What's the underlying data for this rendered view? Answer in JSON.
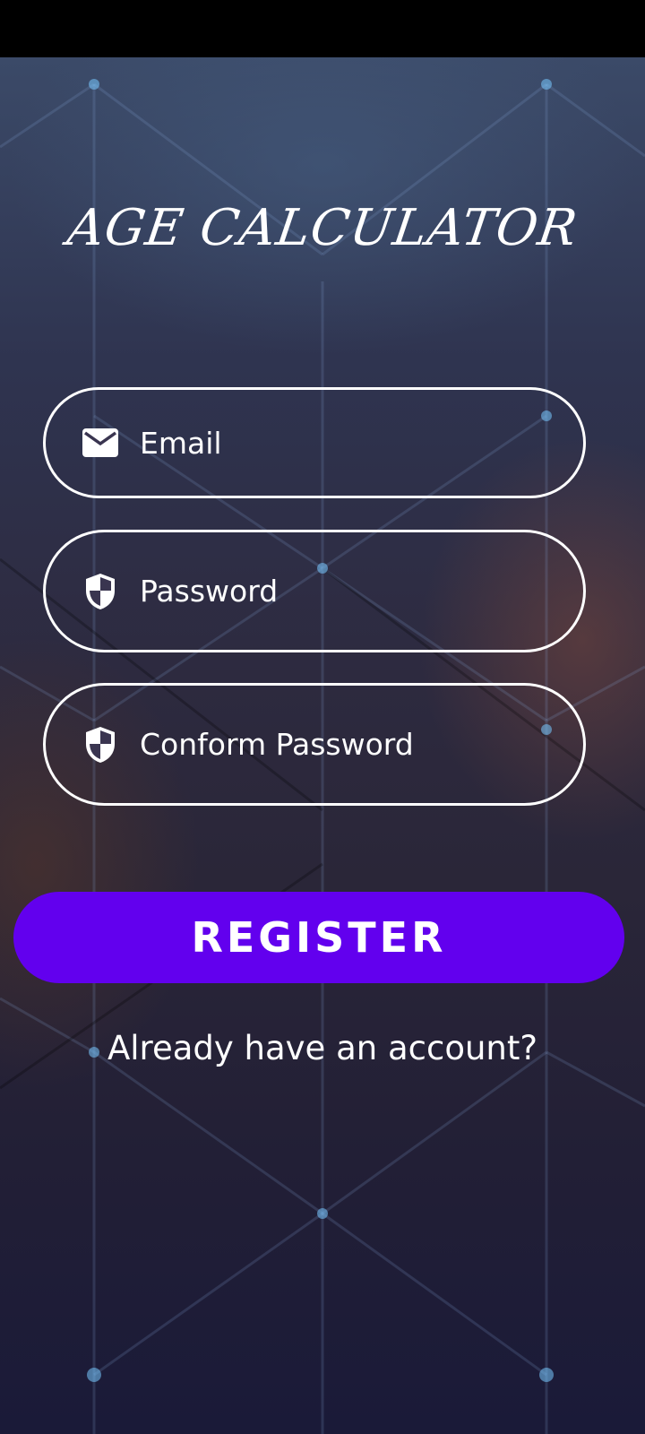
{
  "app": {
    "title": "AGE CALCULATOR"
  },
  "form": {
    "email": {
      "placeholder": "Email",
      "value": "",
      "icon": "mail-icon"
    },
    "password": {
      "placeholder": "Password",
      "value": "",
      "icon": "shield-icon"
    },
    "confirm_password": {
      "placeholder": "Conform Password",
      "value": "",
      "icon": "shield-icon"
    },
    "register_label": "REGISTER",
    "login_link": "Already have an account?"
  },
  "colors": {
    "accent": "#6200ee",
    "field_border": "#ffffff",
    "text": "#ffffff"
  }
}
